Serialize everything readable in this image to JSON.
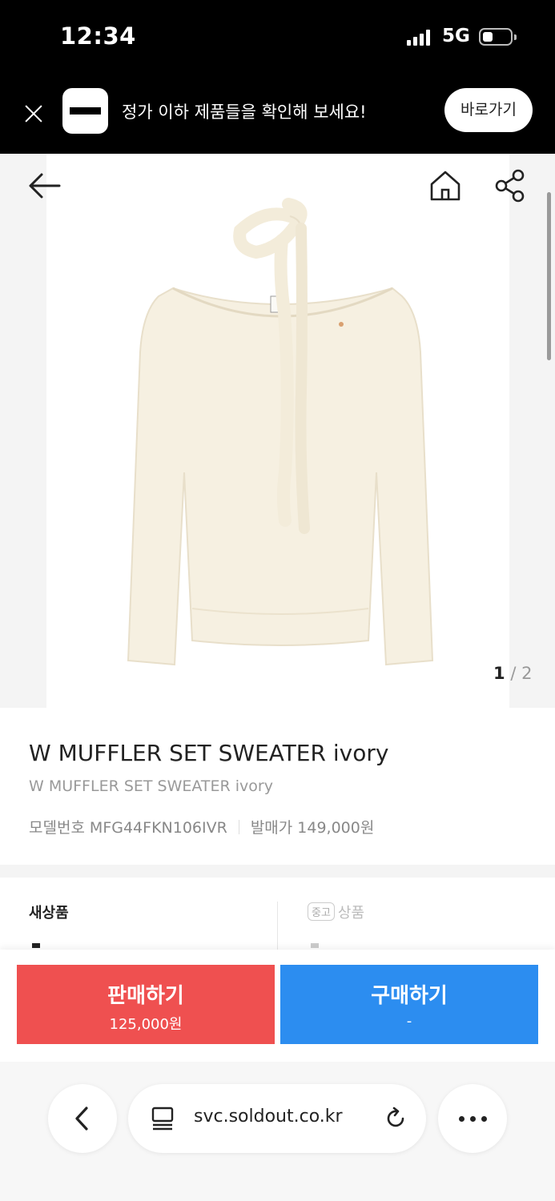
{
  "status_bar": {
    "time": "12:34",
    "network": "5G"
  },
  "promo": {
    "message": "정가 이하 제품들을 확인해 보세요!",
    "cta": "바로가기"
  },
  "gallery": {
    "current": "1",
    "separator": "/",
    "total": "2"
  },
  "product": {
    "title": "W MUFFLER SET SWEATER ivory",
    "subtitle": "W MUFFLER SET SWEATER ivory",
    "model_label": "모델번호",
    "model_value": "MFG44FKN106IVR",
    "release_label": "발매가",
    "release_value": "149,000원"
  },
  "condition": {
    "new_label": "새상품",
    "used_tag": "중고",
    "used_label": "상품"
  },
  "actions": {
    "sell_label": "판매하기",
    "sell_price": "125,000원",
    "buy_label": "구매하기",
    "buy_price": "-"
  },
  "browser": {
    "url": "svc.soldout.co.kr"
  },
  "colors": {
    "sell": "#ef5050",
    "buy": "#2c8df0",
    "banner": "#000000"
  },
  "icons": [
    "close-icon",
    "app-logo-icon",
    "back-arrow-icon",
    "home-icon",
    "share-icon",
    "reader-icon",
    "reload-icon",
    "more-icon",
    "chevron-left-icon"
  ]
}
